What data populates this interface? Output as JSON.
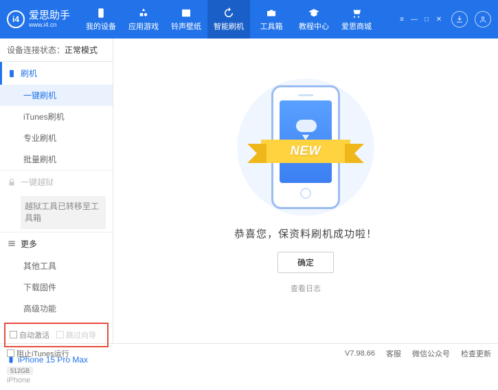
{
  "header": {
    "logo_text": "爱思助手",
    "logo_url": "www.i4.cn",
    "nav": [
      {
        "label": "我的设备"
      },
      {
        "label": "应用游戏"
      },
      {
        "label": "铃声壁纸"
      },
      {
        "label": "智能刷机"
      },
      {
        "label": "工具箱"
      },
      {
        "label": "教程中心"
      },
      {
        "label": "爱思商城"
      }
    ]
  },
  "sidebar": {
    "status_label": "设备连接状态：",
    "status_value": "正常模式",
    "groups": {
      "flash": {
        "title": "刷机",
        "items": [
          "一键刷机",
          "iTunes刷机",
          "专业刷机",
          "批量刷机"
        ]
      },
      "jailbreak": {
        "title": "一键越狱",
        "note": "越狱工具已转移至工具箱"
      },
      "more": {
        "title": "更多",
        "items": [
          "其他工具",
          "下载固件",
          "高级功能"
        ]
      }
    },
    "checks": {
      "auto_activate": "自动激活",
      "skip_guide": "跳过向导"
    },
    "device": {
      "name": "iPhone 15 Pro Max",
      "storage": "512GB",
      "model": "iPhone"
    }
  },
  "main": {
    "ribbon": "NEW",
    "success": "恭喜您，保资料刷机成功啦！",
    "ok": "确定",
    "log": "查看日志"
  },
  "footer": {
    "block_itunes": "阻止iTunes运行",
    "version": "V7.98.66",
    "links": [
      "客服",
      "微信公众号",
      "检查更新"
    ]
  }
}
